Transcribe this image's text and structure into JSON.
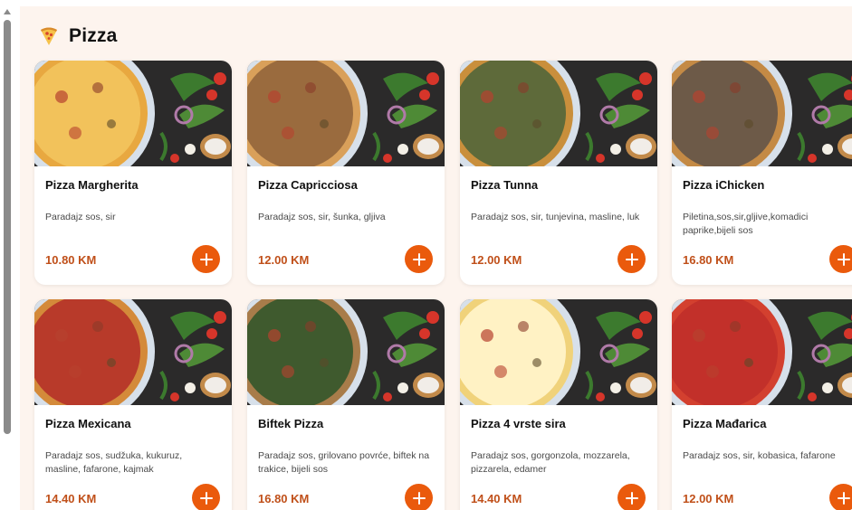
{
  "section": {
    "title": "Pizza",
    "icon": "pizza-slice-icon"
  },
  "accent_color": "#ea5a0c",
  "price_color": "#c0501a",
  "items": [
    {
      "name": "Pizza Margherita",
      "description": "Paradajz sos, sir",
      "price": "10.80 KM",
      "image": "pizza-margherita-photo"
    },
    {
      "name": "Pizza Capricciosa",
      "description": "Paradajz sos, sir, šunka, gljiva",
      "price": "12.00 KM",
      "image": "pizza-capricciosa-photo"
    },
    {
      "name": "Pizza Tunna",
      "description": "Paradajz sos, sir, tunjevina, masline, luk",
      "price": "12.00 KM",
      "image": "pizza-tunna-photo"
    },
    {
      "name": "Pizza iChicken",
      "description": "Piletina,sos,sir,gljive,komadici paprike,bijeli sos",
      "price": "16.80 KM",
      "image": "pizza-ichicken-photo"
    },
    {
      "name": "Pizza Mexicana",
      "description": "Paradajz sos, sudžuka, kukuruz, masline, fafarone, kajmak",
      "price": "14.40 KM",
      "image": "pizza-mexicana-photo"
    },
    {
      "name": "Biftek Pizza",
      "description": "Paradajz sos, grilovano povrće, biftek na trakice, bijeli sos",
      "price": "16.80 KM",
      "image": "biftek-pizza-photo"
    },
    {
      "name": "Pizza 4 vrste sira",
      "description": "Paradajz sos, gorgonzola, mozzarela, pizzarela, edamer",
      "price": "14.40 KM",
      "image": "pizza-4-sira-photo"
    },
    {
      "name": "Pizza Mađarica",
      "description": "Paradajz sos, sir, kobasica, fafarone",
      "price": "12.00 KM",
      "image": "pizza-madjarica-photo"
    }
  ]
}
